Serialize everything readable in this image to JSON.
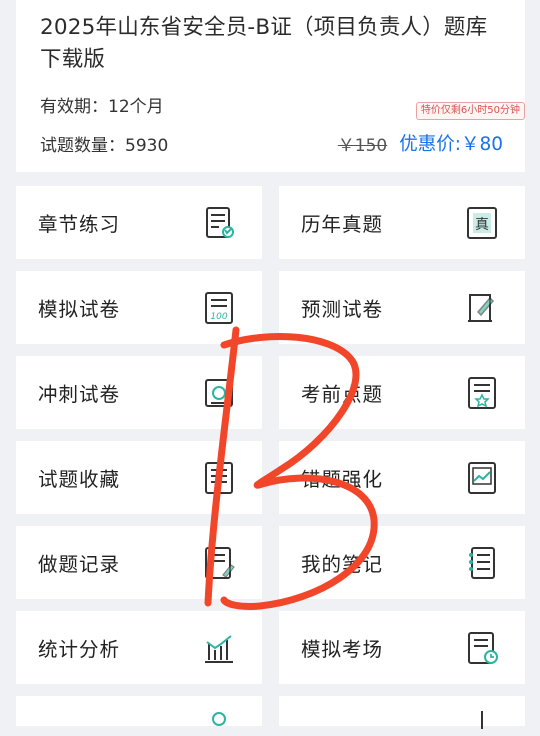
{
  "header": {
    "title": "2025年山东省安全员-B证（项目负责人）题库下载版",
    "validity": "有效期：12个月",
    "question_count": "试题数量：5930",
    "countdown": "特价仅剩6小时50分钟",
    "original_price": "￥150",
    "discount_price": "优惠价:￥80"
  },
  "menu": [
    {
      "label": "章节练习",
      "icon": "chapter-practice-icon"
    },
    {
      "label": "历年真题",
      "icon": "past-exams-icon"
    },
    {
      "label": "模拟试卷",
      "icon": "mock-paper-icon"
    },
    {
      "label": "预测试卷",
      "icon": "predict-paper-icon"
    },
    {
      "label": "冲刺试卷",
      "icon": "sprint-paper-icon"
    },
    {
      "label": "考前点题",
      "icon": "key-points-icon"
    },
    {
      "label": "试题收藏",
      "icon": "favorites-icon"
    },
    {
      "label": "错题强化",
      "icon": "wrong-questions-icon"
    },
    {
      "label": "做题记录",
      "icon": "history-icon"
    },
    {
      "label": "我的笔记",
      "icon": "notes-icon"
    },
    {
      "label": "统计分析",
      "icon": "statistics-icon"
    },
    {
      "label": "模拟考场",
      "icon": "exam-room-icon"
    }
  ],
  "colors": {
    "accent": "#1a73e8",
    "icon_teal": "#2bb5a0",
    "scribble": "#f2462a"
  }
}
